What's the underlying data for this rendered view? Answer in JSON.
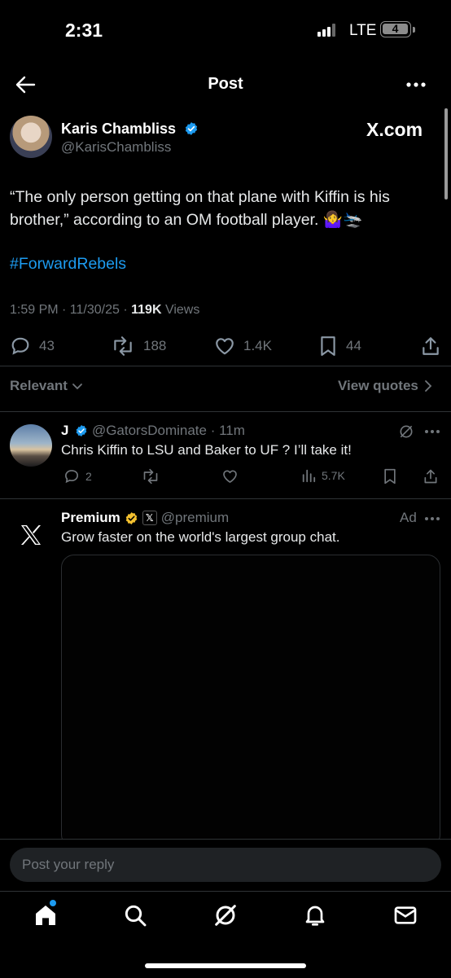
{
  "status_bar": {
    "time": "2:31",
    "network": "LTE",
    "battery": "4"
  },
  "header": {
    "title": "Post"
  },
  "post": {
    "author_name": "Karis Chambliss",
    "author_handle": "@KarisChambliss",
    "brand": "X.com",
    "text": "“The only person getting on that plane with Kiffin is his brother,” according to an OM football player. 🤷‍♀️🛬",
    "hashtag": "#ForwardRebels",
    "timestamp": "1:59 PM · 11/30/25 · ",
    "views_count": "119K",
    "views_label": " Views",
    "replies": "43",
    "reposts": "188",
    "likes": "1.4K",
    "bookmarks": "44"
  },
  "sort": {
    "label": "Relevant",
    "view_quotes": "View quotes"
  },
  "reply": {
    "name": "J",
    "handle": "@GatorsDominate",
    "time": " · 11m",
    "text": "Chris Kiffin to LSU and Baker to UF ? I’ll take it!",
    "replies": "2",
    "views": "5.7K"
  },
  "ad": {
    "name": "Premium",
    "handle": "@premium",
    "label": "Ad",
    "text": "Grow faster on the world's largest group chat."
  },
  "composer": {
    "placeholder": "Post your reply"
  },
  "colors": {
    "accent": "#1d9bf0",
    "background": "#000000",
    "muted": "#71767b",
    "gold": "#f4c12f"
  }
}
